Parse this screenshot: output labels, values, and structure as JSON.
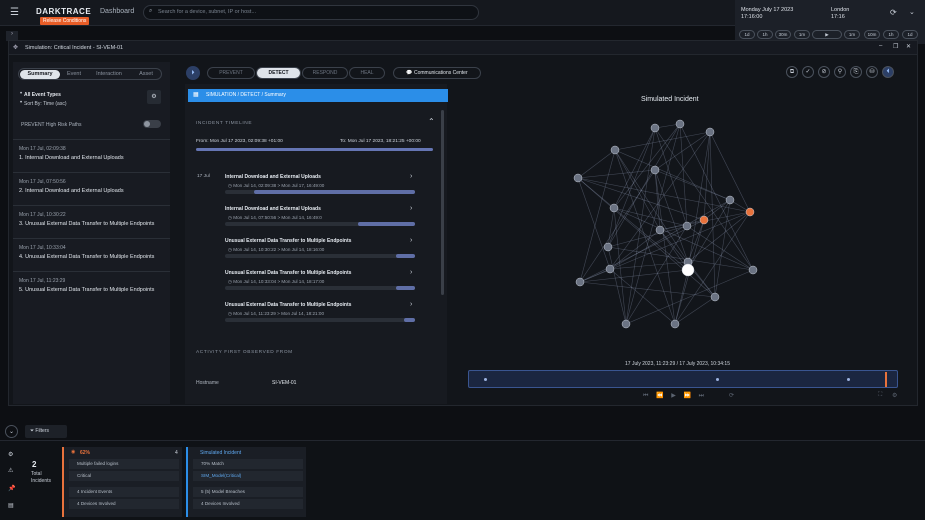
{
  "topbar": {
    "logo": "DARKTRACE",
    "release": "Release Conditions",
    "dashboard": "Dashboard",
    "search_placeholder": "Search for a device, subnet, IP or host...",
    "date": "Monday July 17 2023",
    "time": "17:16:00",
    "city": "London",
    "city_time": "17:16",
    "timeline_buttons": [
      "1d",
      "1h",
      "30m",
      "1m",
      "▶",
      "1m",
      "10m",
      "1h",
      "1d"
    ]
  },
  "window": {
    "title": "Simulation: Critical Incident - SI-VEM-01"
  },
  "left": {
    "tabs": [
      "Summary",
      "Event",
      "Interaction",
      "Asset"
    ],
    "filters": [
      "All Event Types",
      "Sort By: Time (asc)"
    ],
    "toggle_label": "PREVENT High Risk Paths",
    "events": [
      {
        "date": "Mon 17 Jul, 02:09:38",
        "title": "1. Internal Download and External Uploads"
      },
      {
        "date": "Mon 17 Jul, 07:50:56",
        "title": "2. Internal Download and External Uploads"
      },
      {
        "date": "Mon 17 Jul, 10:30:22",
        "title": "3. Unusual External Data Transfer to Multiple Endpoints"
      },
      {
        "date": "Mon 17 Jul, 10:33:04",
        "title": "4. Unusual External Data Transfer to Multiple Endpoints"
      },
      {
        "date": "Mon 17 Jul, 11:23:29",
        "title": "5. Unusual External Data Transfer to Multiple Endpoints"
      }
    ]
  },
  "middle": {
    "breadcrumb": "SIMULATION / DETECT / Summary",
    "timeline_header": "INCIDENT TIMELINE",
    "from": "From: Mon Jul 17 2023, 02:09:38 +01:00",
    "to": "To: Mon Jul 17 2023, 18:21:25 +00:00",
    "date_label": "17 Jul",
    "incidents": [
      {
        "title": "Internal Download and External Uploads",
        "range": "Mon Jul 14, 02:09:38  >  Mon Jul 17, 16:49:00",
        "fill": 0.85
      },
      {
        "title": "Internal Download and External Uploads",
        "range": "Mon Jul 14, 07:50:56  >  Mon Jul 14, 16:49:0",
        "fill": 0.3
      },
      {
        "title": "Unusual External Data Transfer to Multiple Endpoints",
        "range": "Mon Jul 14, 10:30:22  >  Mon Jul 14, 18:16:00",
        "fill": 0.1
      },
      {
        "title": "Unusual External Data Transfer to Multiple Endpoints",
        "range": "Mon Jul 14, 10:33:04  >  Mon Jul 14, 18:17:00",
        "fill": 0.1
      },
      {
        "title": "Unusual External Data Transfer to Multiple Endpoints",
        "range": "Mon Jul 14, 11:23:29  >  Mon Jul 14, 18:21:00",
        "fill": 0.06
      }
    ],
    "activity_header": "ACTIVITY FIRST OBSERVED FROM",
    "hostname_label": "Hostname",
    "hostname_value": "SI-VEM-01"
  },
  "right": {
    "phases": [
      "PREVENT",
      "DETECT",
      "RESPOND",
      "HEAL"
    ],
    "comms": "Communications Center",
    "graph_title": "Simulated Incident",
    "range_label": "17 July 2023, 11:23:29 / 17 July 2023, 10:34:15"
  },
  "bottom": {
    "filters_label": "Filters",
    "count": "2",
    "count_label": "Total Incidents",
    "card1": {
      "header": "62%",
      "badge": "4",
      "row1": "Multiple failed logins",
      "row2": "Critical",
      "row3": "4 Incident Events",
      "row4": "4 Devices Involved"
    },
    "card2": {
      "header": "Simulated Incident",
      "row1": "70% Match",
      "row2": "SIM_Model(Critical)",
      "row3": "5 (5) Model Breaches",
      "row4": "4 Devices Involved"
    }
  },
  "colors": {
    "accent": "#2b8ee8",
    "orange": "#e8723c",
    "bg": "#12151a"
  }
}
